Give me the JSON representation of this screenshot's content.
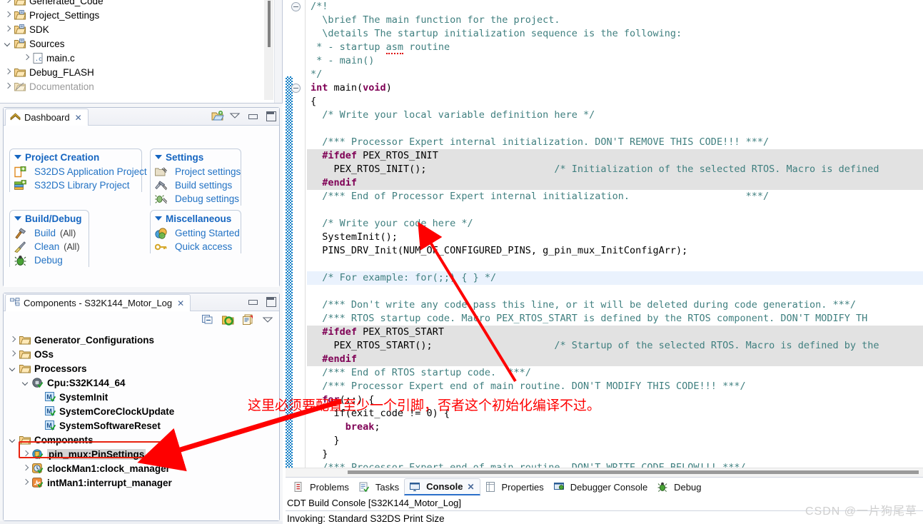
{
  "project_explorer": {
    "name": "project-explorer",
    "items": [
      {
        "label": "Generated_Code",
        "icon": "folder-src-icon",
        "twisty": "right",
        "indent": 0,
        "dim": false
      },
      {
        "label": "Project_Settings",
        "icon": "folder-src-icon",
        "twisty": "right",
        "indent": 0,
        "dim": false
      },
      {
        "label": "SDK",
        "icon": "folder-src-icon",
        "twisty": "right",
        "indent": 0,
        "dim": false
      },
      {
        "label": "Sources",
        "icon": "folder-src-icon",
        "twisty": "down",
        "indent": 0,
        "dim": false
      },
      {
        "label": "main.c",
        "icon": "c-file-icon",
        "twisty": "right",
        "indent": 1,
        "dim": false
      },
      {
        "label": "Debug_FLASH",
        "icon": "folder-icon",
        "twisty": "right",
        "indent": 0,
        "dim": false
      },
      {
        "label": "Documentation",
        "icon": "folder-link-icon",
        "twisty": "right",
        "indent": 0,
        "dim": true
      }
    ]
  },
  "dashboard": {
    "tab_title": "Dashboard",
    "tab_close": "✕",
    "toolbar": [
      {
        "name": "open-project-icon",
        "title": "Open Project"
      },
      {
        "name": "view-menu-icon",
        "title": "View Menu"
      },
      {
        "name": "minimize-icon",
        "title": "Minimize"
      },
      {
        "name": "maximize-icon",
        "title": "Maximize"
      }
    ],
    "groups": [
      {
        "title": "Project Creation",
        "items": [
          {
            "label": "S32DS Application Project",
            "sub": "",
            "icon": "new-app-project-icon"
          },
          {
            "label": "S32DS Library Project",
            "sub": "",
            "icon": "new-library-project-icon"
          }
        ]
      },
      {
        "title": "Build/Debug",
        "items": [
          {
            "label": "Build",
            "sub": "(All)",
            "icon": "hammer-icon"
          },
          {
            "label": "Clean",
            "sub": "(All)",
            "icon": "broom-icon"
          },
          {
            "label": "Debug",
            "sub": "",
            "icon": "bug-icon"
          }
        ]
      },
      {
        "title": "Settings",
        "items": [
          {
            "label": "Project settings",
            "sub": "",
            "icon": "project-settings-icon"
          },
          {
            "label": "Build settings",
            "sub": "",
            "icon": "build-settings-icon"
          },
          {
            "label": "Debug settings",
            "sub": "",
            "icon": "debug-settings-icon"
          }
        ]
      },
      {
        "title": "Miscellaneous",
        "items": [
          {
            "label": "Getting Started",
            "sub": "",
            "icon": "getting-started-icon"
          },
          {
            "label": "Quick access",
            "sub": "",
            "icon": "key-icon"
          }
        ]
      }
    ]
  },
  "components": {
    "tab_title": "Components - S32K144_Motor_Log",
    "tab_close": "✕",
    "window_buttons": [
      {
        "name": "minimize-icon"
      },
      {
        "name": "maximize-icon"
      }
    ],
    "toolbar": [
      {
        "name": "collapse-all-icon"
      },
      {
        "name": "generate-code-icon"
      },
      {
        "name": "import-component-icon"
      },
      {
        "name": "view-menu-icon"
      }
    ],
    "tree": [
      {
        "label": "Generator_Configurations",
        "icon": "folder-icon",
        "twisty": "right",
        "indent": 0,
        "selected": false
      },
      {
        "label": "OSs",
        "icon": "folder-icon",
        "twisty": "right",
        "indent": 0,
        "selected": false
      },
      {
        "label": "Processors",
        "icon": "folder-icon",
        "twisty": "down",
        "indent": 0,
        "selected": false
      },
      {
        "label": "Cpu:S32K144_64",
        "icon": "cpu-icon",
        "twisty": "down",
        "indent": 1,
        "selected": false
      },
      {
        "label": "SystemInit",
        "icon": "method-icon",
        "twisty": "none",
        "indent": 2,
        "selected": false
      },
      {
        "label": "SystemCoreClockUpdate",
        "icon": "method-icon",
        "twisty": "none",
        "indent": 2,
        "selected": false
      },
      {
        "label": "SystemSoftwareReset",
        "icon": "method-icon",
        "twisty": "none",
        "indent": 2,
        "selected": false
      },
      {
        "label": "Components",
        "icon": "folder-icon",
        "twisty": "down",
        "indent": 0,
        "selected": false
      },
      {
        "label": "pin_mux:PinSettings",
        "icon": "pin-component-icon",
        "twisty": "right",
        "indent": 1,
        "selected": true
      },
      {
        "label": "clockMan1:clock_manager",
        "icon": "clock-component-icon",
        "twisty": "right",
        "indent": 1,
        "selected": false
      },
      {
        "label": "intMan1:interrupt_manager",
        "icon": "int-component-icon",
        "twisty": "right",
        "indent": 1,
        "selected": false
      }
    ]
  },
  "annotation": {
    "text": "这里必须要配置至少一个引脚，否者这个初始化编译不过。",
    "color": "#fe0000",
    "arrow_from_tree": "arrow-to-pin-mux",
    "arrow_to_code": "arrow-to-pins-drv-init"
  },
  "editor": {
    "lines": [
      {
        "fold": true,
        "hl": "",
        "tokens": [
          {
            "t": "/*!",
            "c": "cmt"
          }
        ]
      },
      {
        "fold": false,
        "hl": "",
        "tokens": [
          {
            "t": "  \\brief The main function for the project.",
            "c": "cmt"
          }
        ]
      },
      {
        "fold": false,
        "hl": "",
        "tokens": [
          {
            "t": "  \\details The startup initialization sequence is the following:",
            "c": "cmt"
          }
        ]
      },
      {
        "fold": false,
        "hl": "",
        "tokens": [
          {
            "t": " * - startup ",
            "c": "cmt"
          },
          {
            "t": "asm",
            "c": "cmt-squig"
          },
          {
            "t": " routine",
            "c": "cmt"
          }
        ]
      },
      {
        "fold": false,
        "hl": "",
        "tokens": [
          {
            "t": " * - main()",
            "c": "cmt"
          }
        ]
      },
      {
        "fold": false,
        "hl": "",
        "tokens": [
          {
            "t": "*/",
            "c": "cmt"
          }
        ]
      },
      {
        "fold": true,
        "hl": "",
        "tokens": [
          {
            "t": "int ",
            "c": "kw"
          },
          {
            "t": "main",
            "c": "plain-b"
          },
          {
            "t": "(",
            "c": "plain"
          },
          {
            "t": "void",
            "c": "kw"
          },
          {
            "t": ")",
            "c": "plain"
          }
        ]
      },
      {
        "fold": false,
        "hl": "",
        "tokens": [
          {
            "t": "{",
            "c": "plain"
          }
        ]
      },
      {
        "fold": false,
        "hl": "",
        "tokens": [
          {
            "t": "  /* Write your local variable definition here */",
            "c": "cmt"
          }
        ]
      },
      {
        "fold": false,
        "hl": "",
        "tokens": [
          {
            "t": "",
            "c": "plain"
          }
        ]
      },
      {
        "fold": false,
        "hl": "",
        "tokens": [
          {
            "t": "  /*** Processor Expert internal initialization. DON'T REMOVE THIS CODE!!! ***/",
            "c": "cmt"
          }
        ]
      },
      {
        "fold": false,
        "hl": "grey",
        "tokens": [
          {
            "t": "  #ifdef ",
            "c": "pre"
          },
          {
            "t": "PEX_RTOS_INIT",
            "c": "plain"
          }
        ]
      },
      {
        "fold": false,
        "hl": "grey",
        "tokens": [
          {
            "t": "    PEX_RTOS_INIT();                      ",
            "c": "plain"
          },
          {
            "t": "/* Initialization of the selected RTOS. Macro is defined",
            "c": "cmt"
          }
        ]
      },
      {
        "fold": false,
        "hl": "grey",
        "tokens": [
          {
            "t": "  #endif",
            "c": "pre"
          }
        ]
      },
      {
        "fold": false,
        "hl": "",
        "tokens": [
          {
            "t": "  /*** End of Processor Expert internal initialization.                    ***/",
            "c": "cmt"
          }
        ]
      },
      {
        "fold": false,
        "hl": "",
        "tokens": [
          {
            "t": "",
            "c": "plain"
          }
        ]
      },
      {
        "fold": false,
        "hl": "",
        "tokens": [
          {
            "t": "  /* Write your code here */",
            "c": "cmt"
          }
        ]
      },
      {
        "fold": false,
        "hl": "",
        "tokens": [
          {
            "t": "  SystemInit();",
            "c": "plain"
          }
        ]
      },
      {
        "fold": false,
        "hl": "",
        "tokens": [
          {
            "t": "  PINS_DRV_Init(NUM_OF_CONFIGURED_PINS, g_pin_mux_InitConfigArr);",
            "c": "plain"
          }
        ]
      },
      {
        "fold": false,
        "hl": "",
        "tokens": [
          {
            "t": "",
            "c": "plain"
          }
        ]
      },
      {
        "fold": false,
        "hl": "blue",
        "tokens": [
          {
            "t": "  /* For example: for(;;) { } */",
            "c": "cmt"
          }
        ]
      },
      {
        "fold": false,
        "hl": "",
        "tokens": [
          {
            "t": "",
            "c": "plain"
          }
        ]
      },
      {
        "fold": false,
        "hl": "",
        "tokens": [
          {
            "t": "  /*** Don't write any code pass this line, or it will be deleted during code generation. ***/",
            "c": "cmt"
          }
        ]
      },
      {
        "fold": false,
        "hl": "",
        "tokens": [
          {
            "t": "  /*** RTOS startup code. Macro PEX_RTOS_START is defined by the RTOS component. DON'T MODIFY TH",
            "c": "cmt"
          }
        ]
      },
      {
        "fold": false,
        "hl": "grey",
        "tokens": [
          {
            "t": "  #ifdef ",
            "c": "pre"
          },
          {
            "t": "PEX_RTOS_START",
            "c": "plain"
          }
        ]
      },
      {
        "fold": false,
        "hl": "grey",
        "tokens": [
          {
            "t": "    PEX_RTOS_START();                     ",
            "c": "plain"
          },
          {
            "t": "/* Startup of the selected RTOS. Macro is defined by the",
            "c": "cmt"
          }
        ]
      },
      {
        "fold": false,
        "hl": "grey",
        "tokens": [
          {
            "t": "  #endif",
            "c": "pre"
          }
        ]
      },
      {
        "fold": false,
        "hl": "",
        "tokens": [
          {
            "t": "  /*** End of RTOS startup code.  ***/",
            "c": "cmt"
          }
        ]
      },
      {
        "fold": false,
        "hl": "",
        "tokens": [
          {
            "t": "  /*** Processor Expert end of main routine. DON'T MODIFY THIS CODE!!! ***/",
            "c": "cmt"
          }
        ]
      },
      {
        "fold": false,
        "hl": "",
        "tokens": [
          {
            "t": "  for",
            "c": "kw"
          },
          {
            "t": "(;;) {",
            "c": "plain"
          }
        ]
      },
      {
        "fold": false,
        "hl": "",
        "tokens": [
          {
            "t": "    if(exit_code != 0) {",
            "c": "plain"
          }
        ]
      },
      {
        "fold": false,
        "hl": "",
        "tokens": [
          {
            "t": "      break",
            "c": "kw"
          },
          {
            "t": ";",
            "c": "plain"
          }
        ]
      },
      {
        "fold": false,
        "hl": "",
        "tokens": [
          {
            "t": "    }",
            "c": "plain"
          }
        ]
      },
      {
        "fold": false,
        "hl": "",
        "tokens": [
          {
            "t": "  }",
            "c": "plain"
          }
        ]
      },
      {
        "fold": false,
        "hl": "",
        "tokens": [
          {
            "t": "  /*** Processor Expert end of main routine. DON'T WRITE CODE BELOW!!! ***/",
            "c": "cmt"
          }
        ]
      }
    ]
  },
  "bottom_panel": {
    "tabs": [
      {
        "label": "Problems",
        "icon": "problems-icon",
        "active": false
      },
      {
        "label": "Tasks",
        "icon": "tasks-icon",
        "active": false
      },
      {
        "label": "Console",
        "icon": "console-icon",
        "active": true
      },
      {
        "label": "Properties",
        "icon": "properties-icon",
        "active": false
      },
      {
        "label": "Debugger Console",
        "icon": "debugger-console-icon",
        "active": false
      },
      {
        "label": "Debug",
        "icon": "debug-icon",
        "active": false
      }
    ],
    "tab_close": "✕",
    "console_title": "CDT Build Console [S32K144_Motor_Log]",
    "console_first_line": "Invoking: Standard S32DS Print Size"
  },
  "watermark": "CSDN @一片狗尾草"
}
